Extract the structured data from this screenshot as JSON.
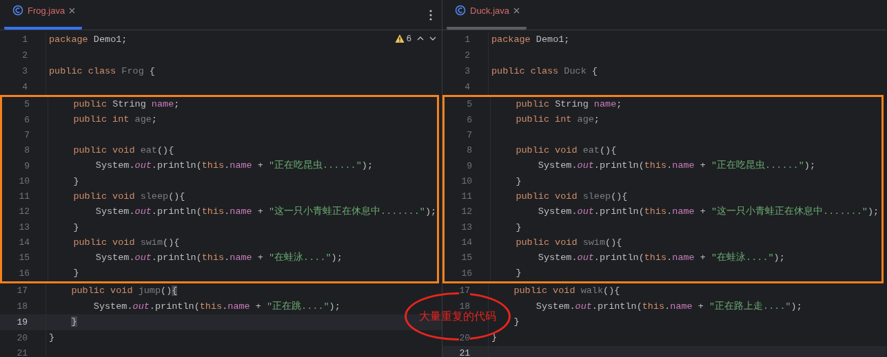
{
  "panes": [
    {
      "focused": true,
      "tab": {
        "label": "Frog.java",
        "selected": true
      },
      "inspections": {
        "count": "6"
      },
      "lines": [
        {
          "number": "1",
          "current": false,
          "in_box": false,
          "tokens": [
            {
              "kind": "kw",
              "text": "package"
            },
            {
              "kind": "plain",
              "text": " Demo1;"
            }
          ]
        },
        {
          "number": "2",
          "current": false,
          "in_box": false
        },
        {
          "number": "3",
          "current": false,
          "in_box": false,
          "tokens": [
            {
              "kind": "kw",
              "text": "public class "
            },
            {
              "kind": "dim",
              "text": "Frog"
            },
            {
              "kind": "plain",
              "text": " {"
            }
          ]
        },
        {
          "number": "4",
          "current": false,
          "in_box": false
        },
        {
          "number": "5",
          "current": false,
          "in_box": true,
          "tokens": [
            {
              "kind": "kw",
              "text": "    public "
            },
            {
              "kind": "plain",
              "text": "String "
            },
            {
              "kind": "field",
              "text": "name"
            },
            {
              "kind": "plain",
              "text": ";"
            }
          ]
        },
        {
          "number": "6",
          "current": false,
          "in_box": true,
          "tokens": [
            {
              "kind": "kw",
              "text": "    public int "
            },
            {
              "kind": "dim",
              "text": "age"
            },
            {
              "kind": "plain",
              "text": ";"
            }
          ]
        },
        {
          "number": "7",
          "current": false,
          "in_box": true
        },
        {
          "number": "8",
          "current": false,
          "in_box": true,
          "tokens": [
            {
              "kind": "kw",
              "text": "    public void "
            },
            {
              "kind": "dim",
              "text": "eat"
            },
            {
              "kind": "plain",
              "text": "(){"
            }
          ]
        },
        {
          "number": "9",
          "current": false,
          "in_box": true,
          "tokens": [
            {
              "kind": "plain",
              "text": "        System."
            },
            {
              "kind": "static",
              "text": "out"
            },
            {
              "kind": "plain",
              "text": ".println("
            },
            {
              "kind": "kw",
              "text": "this"
            },
            {
              "kind": "plain",
              "text": "."
            },
            {
              "kind": "field",
              "text": "name"
            },
            {
              "kind": "plain",
              "text": " + "
            },
            {
              "kind": "str",
              "text": "\"正在吃昆虫......\""
            },
            {
              "kind": "plain",
              "text": ");"
            }
          ]
        },
        {
          "number": "10",
          "current": false,
          "in_box": true,
          "tokens": [
            {
              "kind": "plain",
              "text": "    }"
            }
          ]
        },
        {
          "number": "11",
          "current": false,
          "in_box": true,
          "tokens": [
            {
              "kind": "kw",
              "text": "    public void "
            },
            {
              "kind": "dim",
              "text": "sleep"
            },
            {
              "kind": "plain",
              "text": "(){"
            }
          ]
        },
        {
          "number": "12",
          "current": false,
          "in_box": true,
          "tokens": [
            {
              "kind": "plain",
              "text": "        System."
            },
            {
              "kind": "static",
              "text": "out"
            },
            {
              "kind": "plain",
              "text": ".println("
            },
            {
              "kind": "kw",
              "text": "this"
            },
            {
              "kind": "plain",
              "text": "."
            },
            {
              "kind": "field",
              "text": "name"
            },
            {
              "kind": "plain",
              "text": " + "
            },
            {
              "kind": "str",
              "text": "\"这一只小青蛙正在休息中.......\""
            },
            {
              "kind": "plain",
              "text": ");"
            }
          ]
        },
        {
          "number": "13",
          "current": false,
          "in_box": true,
          "tokens": [
            {
              "kind": "plain",
              "text": "    }"
            }
          ]
        },
        {
          "number": "14",
          "current": false,
          "in_box": true,
          "tokens": [
            {
              "kind": "kw",
              "text": "    public void "
            },
            {
              "kind": "dim",
              "text": "swim"
            },
            {
              "kind": "plain",
              "text": "(){"
            }
          ]
        },
        {
          "number": "15",
          "current": false,
          "in_box": true,
          "tokens": [
            {
              "kind": "plain",
              "text": "        System."
            },
            {
              "kind": "static",
              "text": "out"
            },
            {
              "kind": "plain",
              "text": ".println("
            },
            {
              "kind": "kw",
              "text": "this"
            },
            {
              "kind": "plain",
              "text": "."
            },
            {
              "kind": "field",
              "text": "name"
            },
            {
              "kind": "plain",
              "text": " + "
            },
            {
              "kind": "str",
              "text": "\"在蛙泳....\""
            },
            {
              "kind": "plain",
              "text": ");"
            }
          ]
        },
        {
          "number": "16",
          "current": false,
          "in_box": true,
          "tokens": [
            {
              "kind": "plain",
              "text": "    }"
            }
          ]
        },
        {
          "number": "17",
          "current": false,
          "in_box": false,
          "tokens": [
            {
              "kind": "kw",
              "text": "    public void "
            },
            {
              "kind": "dim",
              "text": "jump"
            },
            {
              "kind": "plain",
              "text": "()"
            },
            {
              "kind": "match",
              "text": "{"
            }
          ]
        },
        {
          "number": "18",
          "current": false,
          "in_box": false,
          "tokens": [
            {
              "kind": "plain",
              "text": "        System."
            },
            {
              "kind": "static",
              "text": "out"
            },
            {
              "kind": "plain",
              "text": ".println("
            },
            {
              "kind": "kw",
              "text": "this"
            },
            {
              "kind": "plain",
              "text": "."
            },
            {
              "kind": "field",
              "text": "name"
            },
            {
              "kind": "plain",
              "text": " + "
            },
            {
              "kind": "str",
              "text": "\"正在跳....\""
            },
            {
              "kind": "plain",
              "text": ");"
            }
          ]
        },
        {
          "number": "19",
          "current": true,
          "in_box": false,
          "tokens": [
            {
              "kind": "match",
              "text": "    }"
            }
          ]
        },
        {
          "number": "20",
          "current": false,
          "in_box": false,
          "tokens": [
            {
              "kind": "plain",
              "text": "}"
            }
          ]
        },
        {
          "number": "21",
          "current": false,
          "in_box": false
        }
      ]
    },
    {
      "focused": false,
      "tab": {
        "label": "Duck.java",
        "selected": true
      },
      "lines": [
        {
          "number": "1",
          "current": false,
          "in_box": false,
          "tokens": [
            {
              "kind": "kw",
              "text": "package"
            },
            {
              "kind": "plain",
              "text": " Demo1;"
            }
          ]
        },
        {
          "number": "2",
          "current": false,
          "in_box": false
        },
        {
          "number": "3",
          "current": false,
          "in_box": false,
          "tokens": [
            {
              "kind": "kw",
              "text": "public class "
            },
            {
              "kind": "dim",
              "text": "Duck"
            },
            {
              "kind": "plain",
              "text": " {"
            }
          ]
        },
        {
          "number": "4",
          "current": false,
          "in_box": false
        },
        {
          "number": "5",
          "current": false,
          "in_box": true,
          "tokens": [
            {
              "kind": "kw",
              "text": "    public "
            },
            {
              "kind": "plain",
              "text": "String "
            },
            {
              "kind": "field",
              "text": "name"
            },
            {
              "kind": "plain",
              "text": ";"
            }
          ]
        },
        {
          "number": "6",
          "current": false,
          "in_box": true,
          "tokens": [
            {
              "kind": "kw",
              "text": "    public int "
            },
            {
              "kind": "dim",
              "text": "age"
            },
            {
              "kind": "plain",
              "text": ";"
            }
          ]
        },
        {
          "number": "7",
          "current": false,
          "in_box": true
        },
        {
          "number": "8",
          "current": false,
          "in_box": true,
          "tokens": [
            {
              "kind": "kw",
              "text": "    public void "
            },
            {
              "kind": "dim",
              "text": "eat"
            },
            {
              "kind": "plain",
              "text": "(){"
            }
          ]
        },
        {
          "number": "9",
          "current": false,
          "in_box": true,
          "tokens": [
            {
              "kind": "plain",
              "text": "        System."
            },
            {
              "kind": "static",
              "text": "out"
            },
            {
              "kind": "plain",
              "text": ".println("
            },
            {
              "kind": "kw",
              "text": "this"
            },
            {
              "kind": "plain",
              "text": "."
            },
            {
              "kind": "field",
              "text": "name"
            },
            {
              "kind": "plain",
              "text": " + "
            },
            {
              "kind": "str",
              "text": "\"正在吃昆虫......\""
            },
            {
              "kind": "plain",
              "text": ");"
            }
          ]
        },
        {
          "number": "10",
          "current": false,
          "in_box": true,
          "tokens": [
            {
              "kind": "plain",
              "text": "    }"
            }
          ]
        },
        {
          "number": "11",
          "current": false,
          "in_box": true,
          "tokens": [
            {
              "kind": "kw",
              "text": "    public void "
            },
            {
              "kind": "dim",
              "text": "sleep"
            },
            {
              "kind": "plain",
              "text": "(){"
            }
          ]
        },
        {
          "number": "12",
          "current": false,
          "in_box": true,
          "tokens": [
            {
              "kind": "plain",
              "text": "        System."
            },
            {
              "kind": "static",
              "text": "out"
            },
            {
              "kind": "plain",
              "text": ".println("
            },
            {
              "kind": "kw",
              "text": "this"
            },
            {
              "kind": "plain",
              "text": "."
            },
            {
              "kind": "field",
              "text": "name"
            },
            {
              "kind": "plain",
              "text": " + "
            },
            {
              "kind": "str",
              "text": "\"这一只小青蛙正在休息中.......\""
            },
            {
              "kind": "plain",
              "text": ");"
            }
          ]
        },
        {
          "number": "13",
          "current": false,
          "in_box": true,
          "tokens": [
            {
              "kind": "plain",
              "text": "    }"
            }
          ]
        },
        {
          "number": "14",
          "current": false,
          "in_box": true,
          "tokens": [
            {
              "kind": "kw",
              "text": "    public void "
            },
            {
              "kind": "dim",
              "text": "swim"
            },
            {
              "kind": "plain",
              "text": "(){"
            }
          ]
        },
        {
          "number": "15",
          "current": false,
          "in_box": true,
          "tokens": [
            {
              "kind": "plain",
              "text": "        System."
            },
            {
              "kind": "static",
              "text": "out"
            },
            {
              "kind": "plain",
              "text": ".println("
            },
            {
              "kind": "kw",
              "text": "this"
            },
            {
              "kind": "plain",
              "text": "."
            },
            {
              "kind": "field",
              "text": "name"
            },
            {
              "kind": "plain",
              "text": " + "
            },
            {
              "kind": "str",
              "text": "\"在蛙泳....\""
            },
            {
              "kind": "plain",
              "text": ");"
            }
          ]
        },
        {
          "number": "16",
          "current": false,
          "in_box": true,
          "tokens": [
            {
              "kind": "plain",
              "text": "    }"
            }
          ]
        },
        {
          "number": "17",
          "current": false,
          "in_box": false,
          "tokens": [
            {
              "kind": "kw",
              "text": "    public void "
            },
            {
              "kind": "dim",
              "text": "walk"
            },
            {
              "kind": "plain",
              "text": "(){"
            }
          ]
        },
        {
          "number": "18",
          "current": false,
          "in_box": false,
          "tokens": [
            {
              "kind": "plain",
              "text": "        System."
            },
            {
              "kind": "static",
              "text": "out"
            },
            {
              "kind": "plain",
              "text": ".println("
            },
            {
              "kind": "kw",
              "text": "this"
            },
            {
              "kind": "plain",
              "text": "."
            },
            {
              "kind": "field",
              "text": "name"
            },
            {
              "kind": "plain",
              "text": " + "
            },
            {
              "kind": "str",
              "text": "\"正在路上走....\""
            },
            {
              "kind": "plain",
              "text": ");"
            }
          ]
        },
        {
          "current": false,
          "in_box": false,
          "tokens": [
            {
              "kind": "plain",
              "text": "    }"
            }
          ]
        },
        {
          "number": "20",
          "current": false,
          "in_box": false,
          "tokens": [
            {
              "kind": "plain",
              "text": "}"
            }
          ]
        },
        {
          "number": "21",
          "current": true,
          "in_box": false
        }
      ]
    }
  ],
  "annotation": {
    "text": "大量重复的代码"
  }
}
